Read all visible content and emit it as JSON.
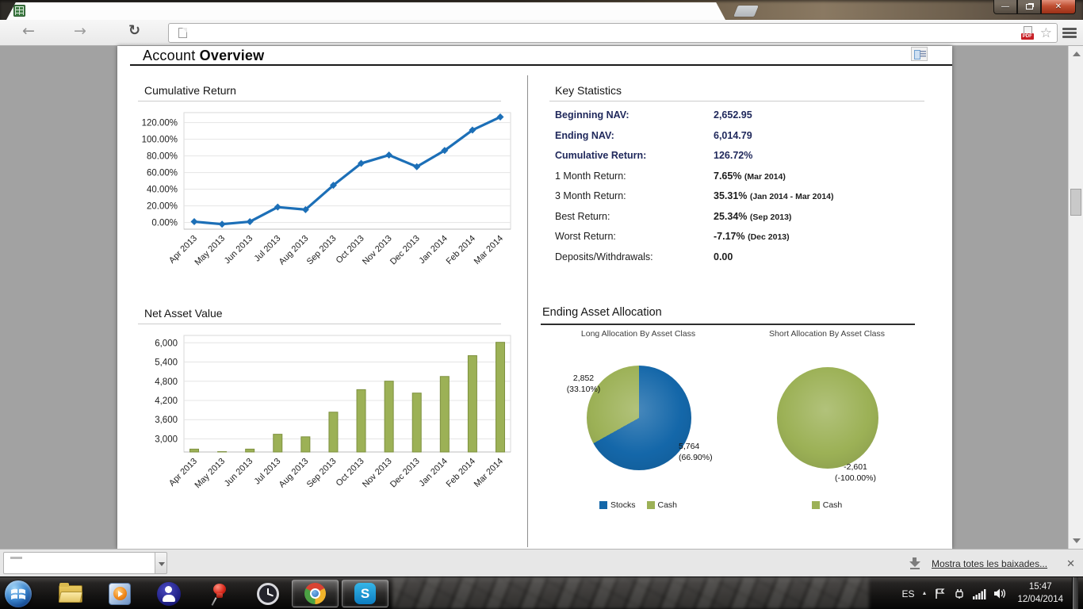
{
  "page": {
    "title_prefix": "Account",
    "title_bold": "Overview"
  },
  "key_statistics": {
    "title": "Key Statistics",
    "rows": [
      {
        "label": "Beginning NAV:",
        "value": "2,652.95",
        "note": "",
        "emphasis": true
      },
      {
        "label": "Ending NAV:",
        "value": "6,014.79",
        "note": "",
        "emphasis": true
      },
      {
        "label": "Cumulative Return:",
        "value": "126.72%",
        "note": "",
        "emphasis": true
      },
      {
        "label": "1 Month Return:",
        "value": "7.65%",
        "note": "(Mar 2014)",
        "emphasis": false
      },
      {
        "label": "3 Month Return:",
        "value": "35.31%",
        "note": "(Jan 2014 - Mar 2014)",
        "emphasis": false
      },
      {
        "label": "Best Return:",
        "value": "25.34%",
        "note": "(Sep 2013)",
        "emphasis": false
      },
      {
        "label": "Worst Return:",
        "value": "-7.17%",
        "note": "(Dec 2013)",
        "emphasis": false
      },
      {
        "label": "Deposits/Withdrawals:",
        "value": "0.00",
        "note": "",
        "emphasis": false
      }
    ]
  },
  "ending_allocation": {
    "title": "Ending Asset Allocation"
  },
  "chart_data": [
    {
      "id": "cumulative-return",
      "type": "line",
      "title": "Cumulative Return",
      "categories": [
        "Apr 2013",
        "May 2013",
        "Jun 2013",
        "Jul 2013",
        "Aug 2013",
        "Sep 2013",
        "Oct 2013",
        "Nov 2013",
        "Dec 2013",
        "Jan 2014",
        "Feb 2014",
        "Mar 2014"
      ],
      "values": [
        1.0,
        -2.0,
        1.0,
        18.5,
        15.5,
        44.7,
        71.0,
        81.0,
        67.0,
        86.5,
        111.0,
        126.72
      ],
      "ylim": [
        -8,
        132
      ],
      "yticks": [
        {
          "v": 0,
          "label": "0.00%"
        },
        {
          "v": 20,
          "label": "20.00%"
        },
        {
          "v": 40,
          "label": "40.00%"
        },
        {
          "v": 60,
          "label": "60.00%"
        },
        {
          "v": 80,
          "label": "80.00%"
        },
        {
          "v": 100,
          "label": "100.00%"
        },
        {
          "v": 120,
          "label": "120.00%"
        }
      ],
      "color": "#1c6fb7",
      "grid": true,
      "legend_position": "none"
    },
    {
      "id": "net-asset-value",
      "type": "bar",
      "title": "Net Asset Value",
      "categories": [
        "Apr 2013",
        "May 2013",
        "Jun 2013",
        "Jul 2013",
        "Aug 2013",
        "Sep 2013",
        "Oct 2013",
        "Nov 2013",
        "Dec 2013",
        "Jan 2014",
        "Feb 2014",
        "Mar 2014"
      ],
      "values": [
        2680,
        2601,
        2680,
        3144,
        3064,
        3834,
        4537,
        4802,
        4430,
        4948,
        5598,
        6015
      ],
      "ylim": [
        2590,
        6230
      ],
      "yticks": [
        {
          "v": 3000,
          "label": "3,000"
        },
        {
          "v": 3600,
          "label": "3,600"
        },
        {
          "v": 4200,
          "label": "4,200"
        },
        {
          "v": 4800,
          "label": "4,800"
        },
        {
          "v": 5400,
          "label": "5,400"
        },
        {
          "v": 6000,
          "label": "6,000"
        }
      ],
      "color": "#9cb156",
      "bar_border": "#7e913f",
      "grid": true,
      "legend_position": "none"
    },
    {
      "type": "pie",
      "title": "Long Allocation By Asset Class",
      "slices": [
        {
          "name": "Stocks",
          "value": "5,764",
          "pct": 66.9,
          "pct_label": "(66.90%)",
          "color": "#1467a9"
        },
        {
          "name": "Cash",
          "value": "2,852",
          "pct": 33.1,
          "pct_label": "(33.10%)",
          "color": "#9cb156"
        }
      ]
    },
    {
      "type": "pie",
      "title": "Short Allocation By Asset Class",
      "slices": [
        {
          "name": "Cash",
          "value": "-2,601",
          "pct": 100.0,
          "pct_label": "(-100.00%)",
          "color": "#9cb156"
        }
      ]
    }
  ],
  "downloads_bar": {
    "show_all": "Mostra totes les baixades...",
    "close": "✕"
  },
  "taskbar": {
    "language": "ES",
    "time": "15:47",
    "date": "12/04/2014"
  }
}
